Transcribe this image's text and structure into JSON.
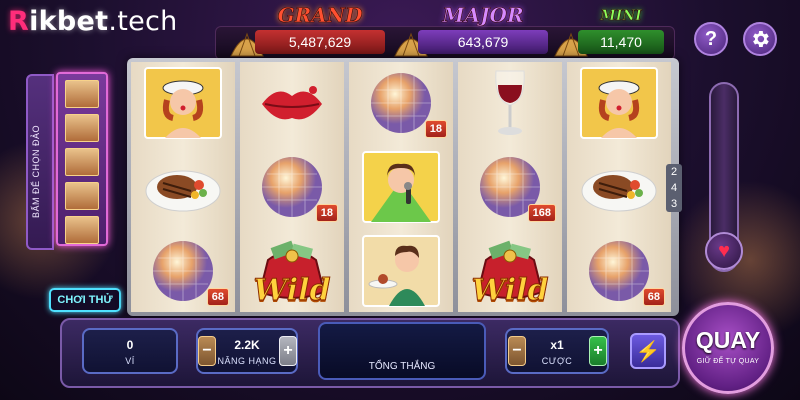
{
  "brand": {
    "r": "R",
    "ik": "ikbet",
    "tech": ".tech"
  },
  "jackpots": {
    "grand": {
      "title": "GRAND",
      "value": "5,487,629"
    },
    "major": {
      "title": "MAJOR",
      "value": "643,679"
    },
    "mini": {
      "title": "MINI",
      "value": "11,470"
    }
  },
  "top_buttons": {
    "help": "?",
    "help_icon": "help-icon",
    "settings_icon": "gear-icon"
  },
  "island_panel": {
    "label": "BẤM ĐỂ CHỌN ĐẢO",
    "thumb_count": 5
  },
  "play_demo": {
    "label": "CHƠI THỬ"
  },
  "reels": {
    "ways": "243",
    "columns": [
      [
        {
          "symbol": "pinup-sailor-lady"
        },
        {
          "symbol": "steak-plate"
        },
        {
          "symbol": "disco-ball",
          "badge": "68"
        }
      ],
      [
        {
          "symbol": "red-lips"
        },
        {
          "symbol": "disco-ball",
          "badge": "18"
        },
        {
          "symbol": "wild-money-bag",
          "wild": "Wild"
        }
      ],
      [
        {
          "symbol": "disco-ball",
          "badge": "18"
        },
        {
          "symbol": "singer-lady"
        },
        {
          "symbol": "waitress-lady"
        }
      ],
      [
        {
          "symbol": "red-wine-glass"
        },
        {
          "symbol": "disco-ball",
          "badge": "168"
        },
        {
          "symbol": "wild-money-bag",
          "wild": "Wild"
        }
      ],
      [
        {
          "symbol": "pinup-sailor-lady"
        },
        {
          "symbol": "steak-plate"
        },
        {
          "symbol": "disco-ball",
          "badge": "68"
        }
      ]
    ]
  },
  "controls": {
    "wallet": {
      "value": "0",
      "label": "VÍ"
    },
    "upgrade": {
      "value": "2.2K",
      "label": "NÂNG HẠNG",
      "minus": "−",
      "plus": "+"
    },
    "total_win": {
      "label": "TỔNG THẮNG"
    },
    "bet": {
      "value": "x1",
      "label": "CƯỢC",
      "minus": "−",
      "plus": "+"
    },
    "turbo_icon": "lightning-icon",
    "spin": {
      "label": "QUAY",
      "hint": "GIỮ ĐỂ TỰ QUAY"
    }
  },
  "colors": {
    "brand_pink": "#ff2d7a",
    "grand": "#c43131",
    "major": "#7d3dbb",
    "mini": "#2f8f2c",
    "spin": "#a84fc6"
  }
}
